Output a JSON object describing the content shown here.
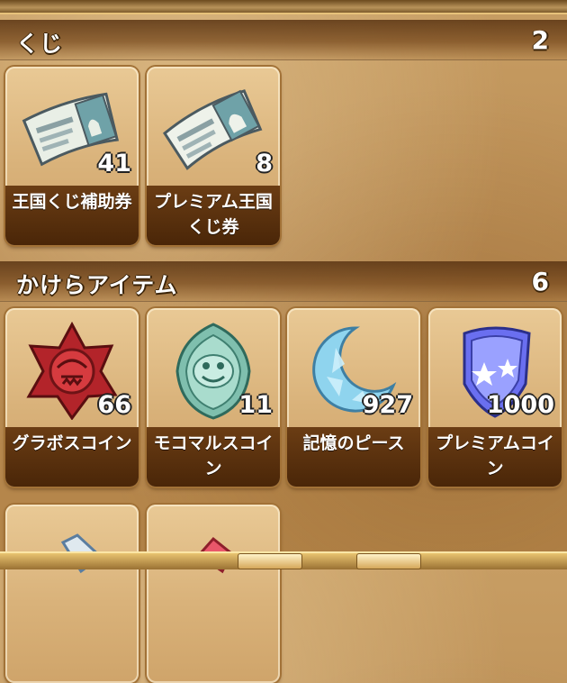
{
  "sections": [
    {
      "title": "くじ",
      "count": "2",
      "items": [
        {
          "label": "王国くじ補助券",
          "count": "41",
          "icon": "lottery-ticket-icon"
        },
        {
          "label": "プレミアム王国くじ券",
          "count": "8",
          "icon": "premium-lottery-ticket-icon"
        }
      ]
    },
    {
      "title": "かけらアイテム",
      "count": "6",
      "items": [
        {
          "label": "グラボスコイン",
          "count": "66",
          "icon": "grabos-coin-icon"
        },
        {
          "label": "モコマルスコイン",
          "count": "11",
          "icon": "mocomarus-coin-icon"
        },
        {
          "label": "記憶のピース",
          "count": "927",
          "icon": "memory-piece-icon"
        },
        {
          "label": "プレミアムコイン",
          "count": "1000",
          "icon": "premium-coin-icon"
        }
      ]
    }
  ]
}
